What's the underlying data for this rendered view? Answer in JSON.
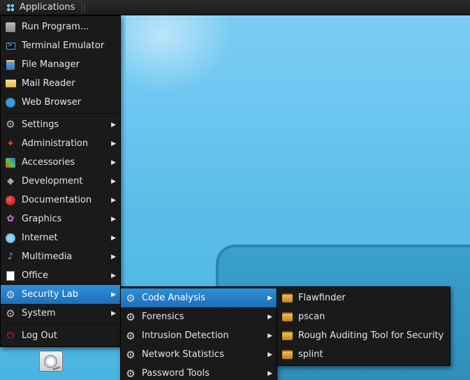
{
  "topbar": {
    "apps_label": "Applications"
  },
  "main_menu": {
    "run": "Run Program...",
    "terminal": "Terminal Emulator",
    "files": "File Manager",
    "mail": "Mail Reader",
    "web": "Web Browser",
    "settings": "Settings",
    "admin": "Administration",
    "acc": "Accessories",
    "dev": "Development",
    "doc": "Documentation",
    "gfx": "Graphics",
    "net": "Internet",
    "media": "Multimedia",
    "office": "Office",
    "seclab": "Security Lab",
    "system": "System",
    "logout": "Log Out"
  },
  "sec_menu": {
    "code": "Code Analysis",
    "foren": "Forensics",
    "intr": "Intrusion Detection",
    "nets": "Network Statistics",
    "pass": "Password Tools"
  },
  "code_menu": {
    "flaw": "Flawfinder",
    "pscan": "pscan",
    "rats": "Rough Auditing Tool for Security",
    "splint": "splint"
  }
}
